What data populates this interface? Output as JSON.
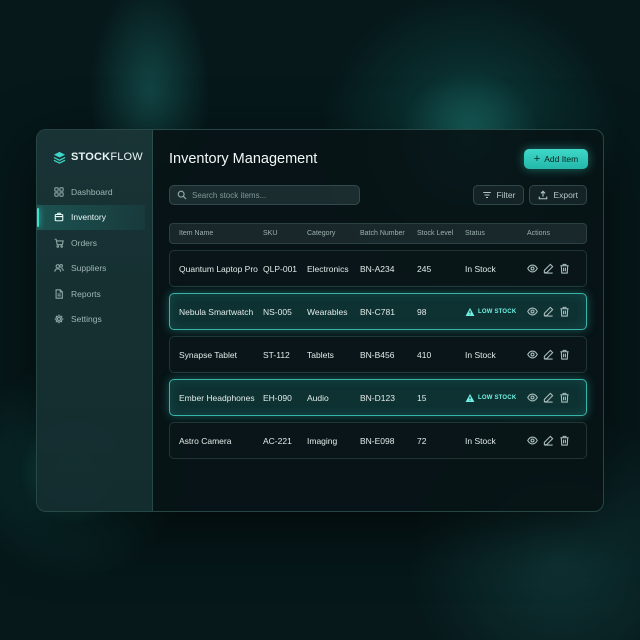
{
  "brand": {
    "name_bold": "STOCK",
    "name_light": "FLOW"
  },
  "colors": {
    "accent": "#3fd8c8",
    "background": "#06181a",
    "panel": "#081416",
    "low_stock": "#6ff0e2"
  },
  "sidebar": {
    "items": [
      {
        "label": "Dashboard",
        "icon": "grid-icon",
        "active": false
      },
      {
        "label": "Inventory",
        "icon": "box-icon",
        "active": true
      },
      {
        "label": "Orders",
        "icon": "cart-icon",
        "active": false
      },
      {
        "label": "Suppliers",
        "icon": "users-icon",
        "active": false
      },
      {
        "label": "Reports",
        "icon": "document-icon",
        "active": false
      },
      {
        "label": "Settings",
        "icon": "gear-icon",
        "active": false
      }
    ]
  },
  "header": {
    "title": "Inventory Management",
    "add_label": "Add Item"
  },
  "toolbar": {
    "search_placeholder": "Search stock items...",
    "filter_label": "Filter",
    "export_label": "Export"
  },
  "table": {
    "columns": [
      "Item Name",
      "SKU",
      "Category",
      "Batch Number",
      "Stock Level",
      "Status",
      "Actions"
    ],
    "rows": [
      {
        "name": "Quantum Laptop Pro",
        "sku": "QLP-001",
        "category": "Electronics",
        "batch": "BN-A234",
        "stock": "245",
        "status": "In Stock"
      },
      {
        "name": "Nebula Smartwatch",
        "sku": "NS-005",
        "category": "Wearables",
        "batch": "BN-C781",
        "stock": "98",
        "status": "LOW STOCK"
      },
      {
        "name": "Synapse Tablet",
        "sku": "ST-112",
        "category": "Tablets",
        "batch": "BN-B456",
        "stock": "410",
        "status": "In Stock"
      },
      {
        "name": "Ember Headphones",
        "sku": "EH-090",
        "category": "Audio",
        "batch": "BN-D123",
        "stock": "15",
        "status": "LOW STOCK"
      },
      {
        "name": "Astro Camera",
        "sku": "AC-221",
        "category": "Imaging",
        "batch": "BN-E098",
        "stock": "72",
        "status": "In Stock"
      }
    ]
  }
}
